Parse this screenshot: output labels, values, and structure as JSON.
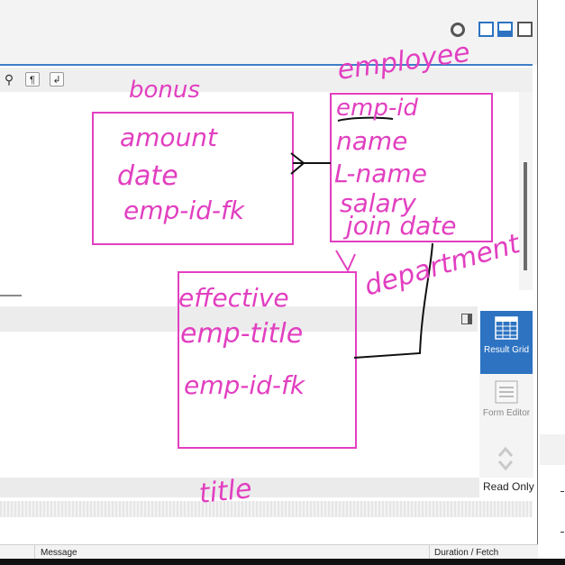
{
  "app": {
    "result_grid_label": "Result Grid",
    "form_editor_label": "Form Editor",
    "read_only_label": "Read Only",
    "output_columns": {
      "message": "Message",
      "duration": "Duration / Fetch"
    }
  },
  "diagram": {
    "ink_color": "#e23fc0",
    "entities": [
      {
        "name": "bonus",
        "fields": [
          "amount",
          "date",
          "emp-id-fk"
        ]
      },
      {
        "name": "employee",
        "fields": [
          "emp-id",
          "name",
          "L-name",
          "salary",
          "join date"
        ]
      },
      {
        "name": "title",
        "fields": [
          "effective",
          "emp-title",
          "emp-id-fk"
        ]
      }
    ],
    "annotations": [
      "department"
    ]
  }
}
